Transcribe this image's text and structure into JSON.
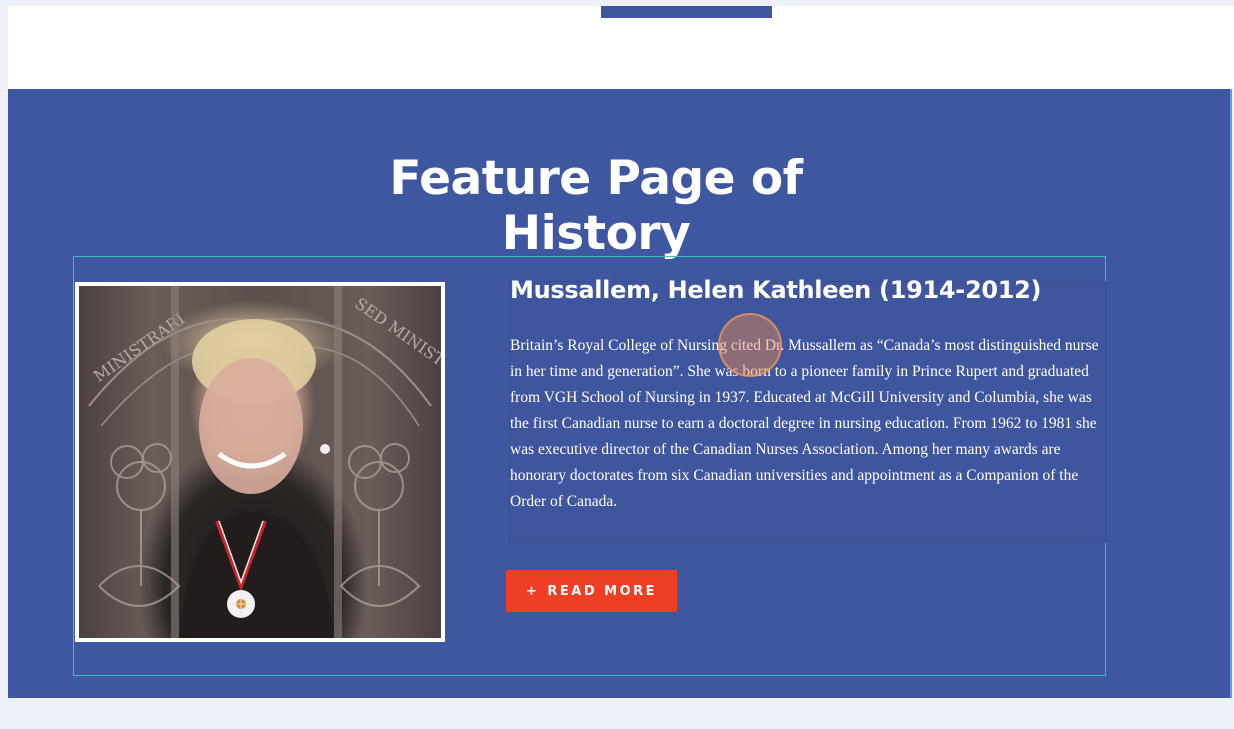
{
  "feature": {
    "title": "Feature Page of History",
    "person": {
      "name": "Mussallem, Helen Kathleen (1914-2012)",
      "bio": "Britain’s Royal College of Nursing cited Dr. Mussallem as “Canada’s most distinguished nurse in her time and generation”.  She was born to a pioneer family in Prince Rupert and graduated from VGH School of Nursing in 1937. Educated at McGill University and Columbia, she was the first Canadian nurse to earn a doctoral degree in nursing education.  From 1962 to 1981 she was executive director of the Canadian Nurses Association.  Among her many awards are honorary doctorates from six Canadian universities and appointment as a Companion of the Order of Canada.",
      "portrait_texts": {
        "left": "MINISTRARI",
        "right": "SED MINISTRA"
      }
    },
    "read_more": {
      "icon": "+",
      "label": "READ MORE"
    }
  },
  "colors": {
    "section_bg": "#3f56a1",
    "button_bg": "#ef3e23",
    "card_border": "#38c5b8",
    "page_bg": "#eef2f8"
  }
}
